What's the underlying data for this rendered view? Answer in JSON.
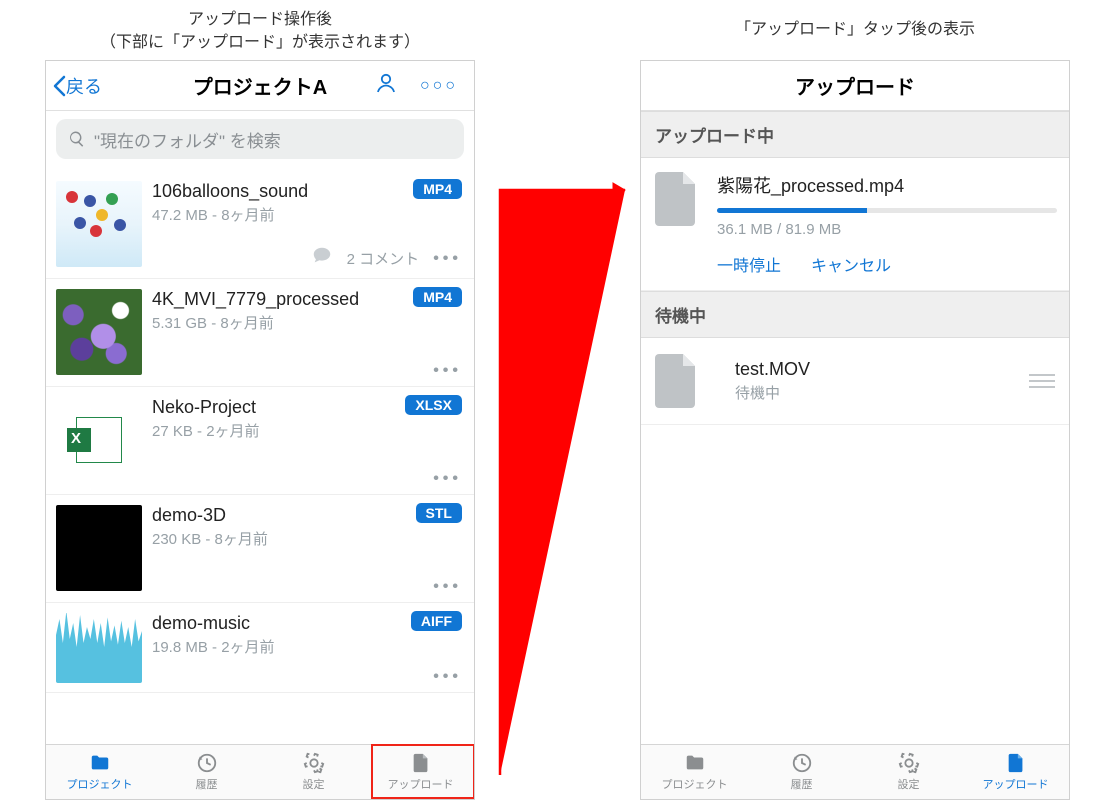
{
  "captions": {
    "left_line1": "アップロード操作後",
    "left_line2": "（下部に「アップロード」が表示されます）",
    "right": "「アップロード」タップ後の表示"
  },
  "left": {
    "nav": {
      "back": "戻る",
      "title": "プロジェクトA"
    },
    "search": {
      "placeholder": "\"現在のフォルダ\" を検索"
    },
    "items": [
      {
        "name": "106balloons_sound",
        "meta": "47.2 MB - 8ヶ月前",
        "badge": "MP4",
        "comments": "2 コメント",
        "thumb": "balloons"
      },
      {
        "name": "4K_MVI_7779_processed",
        "meta": "5.31 GB - 8ヶ月前",
        "badge": "MP4",
        "thumb": "flowers"
      },
      {
        "name": "Neko-Project",
        "meta": "27 KB - 2ヶ月前",
        "badge": "XLSX",
        "thumb": "xlsx"
      },
      {
        "name": "demo-3D",
        "meta": "230 KB - 8ヶ月前",
        "badge": "STL",
        "thumb": "black"
      },
      {
        "name": "demo-music",
        "meta": "19.8 MB - 2ヶ月前",
        "badge": "AIFF",
        "thumb": "audio"
      }
    ],
    "tabs": {
      "projects": "プロジェクト",
      "history": "履歴",
      "settings": "設定",
      "upload": "アップロード"
    }
  },
  "right": {
    "title": "アップロード",
    "section_uploading": "アップロード中",
    "section_waiting": "待機中",
    "uploading": {
      "name": "紫陽花_processed.mp4",
      "size": "36.1 MB / 81.9 MB",
      "progress_pct": 44,
      "pause": "一時停止",
      "cancel": "キャンセル"
    },
    "waiting": {
      "name": "test.MOV",
      "status": "待機中"
    },
    "tabs": {
      "projects": "プロジェクト",
      "history": "履歴",
      "settings": "設定",
      "upload": "アップロード"
    }
  }
}
